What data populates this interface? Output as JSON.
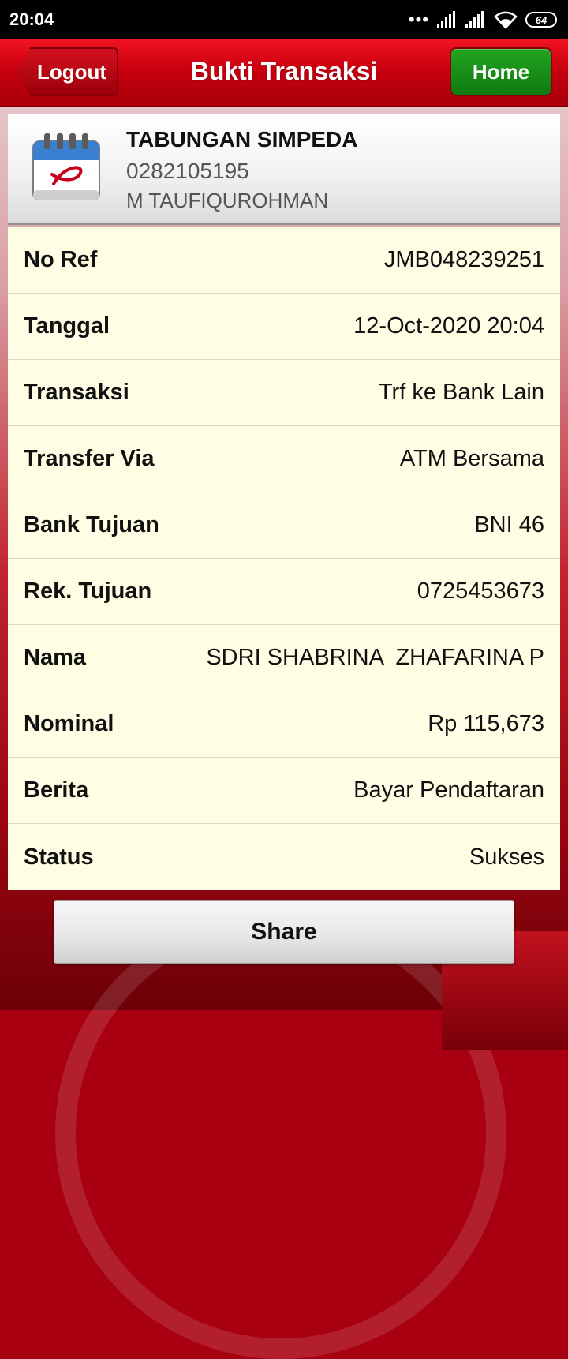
{
  "status_bar": {
    "time": "20:04",
    "battery": "64"
  },
  "header": {
    "title": "Bukti Transaksi",
    "logout_label": "Logout",
    "home_label": "Home"
  },
  "account": {
    "icon": "calendar-icon",
    "product": "TABUNGAN SIMPEDA",
    "number": "0282105195",
    "holder": "M TAUFIQUROHMAN"
  },
  "details": [
    {
      "label": "No Ref",
      "value": "JMB048239251"
    },
    {
      "label": "Tanggal",
      "value": "12-Oct-2020 20:04"
    },
    {
      "label": "Transaksi",
      "value": "Trf ke Bank Lain"
    },
    {
      "label": "Transfer Via",
      "value": "ATM Bersama"
    },
    {
      "label": "Bank Tujuan",
      "value": "BNI 46"
    },
    {
      "label": "Rek. Tujuan",
      "value": "0725453673"
    },
    {
      "label": "Nama",
      "value": "SDRI SHABRINA  ZHAFARINA P"
    },
    {
      "label": "Nominal",
      "value": "Rp 115,673"
    },
    {
      "label": "Berita",
      "value": "Bayar Pendaftaran"
    },
    {
      "label": "Status",
      "value": "Sukses"
    }
  ],
  "share_label": "Share",
  "colors": {
    "header_red": "#c9000f",
    "home_green": "#13861a",
    "detail_bg": "#fffee4"
  }
}
